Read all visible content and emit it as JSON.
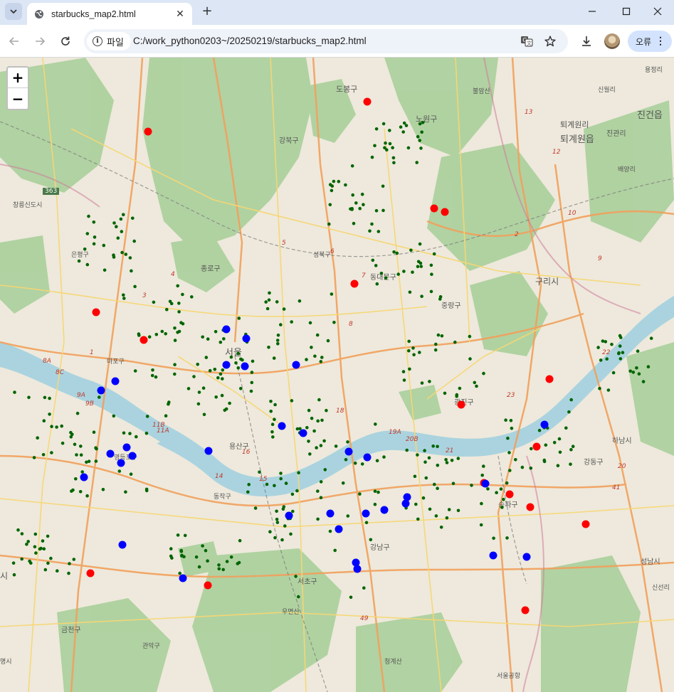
{
  "browser": {
    "tab_title": "starbucks_map2.html",
    "chip_label": "파일",
    "url": "C:/work_python0203~/20250219/starbucks_map2.html",
    "error_label": "오류",
    "new_tab_glyph": "+",
    "close_glyph": "✕",
    "menu_glyph": "⌄",
    "dots_glyph": "⋮",
    "colors": {
      "tabbar": "#dce6f5",
      "pill": "#d3e3fd"
    }
  },
  "map": {
    "zoom_in_label": "+",
    "zoom_out_label": "−",
    "colors": {
      "red_marker": "#ff0000",
      "blue_marker": "#0000ff",
      "green_marker": "#006400",
      "river": "#aad3df",
      "forest": "#add19e"
    },
    "place_labels": [
      "도봉구",
      "노원구",
      "불암산",
      "퇴계원리",
      "퇴계원읍",
      "진건읍",
      "신월리",
      "용정리",
      "진관리",
      "배양리",
      "강북구",
      "성북구",
      "종로구",
      "중랑구",
      "동대문구",
      "구리시",
      "서울",
      "용산구",
      "광진구",
      "마포구",
      "영등포구",
      "동작구",
      "서초구",
      "강남구",
      "송파구",
      "강동구",
      "우면산",
      "금천구",
      "관악구",
      "청계산",
      "서울공항",
      "성남시",
      "하남시",
      "신선리",
      "창릉신도시",
      "은평구",
      "명시",
      "시",
      "363"
    ],
    "route_labels": [
      "13",
      "12",
      "10",
      "9",
      "8",
      "7",
      "6",
      "5",
      "4",
      "3",
      "2",
      "1",
      "8A",
      "8C",
      "9A",
      "9B",
      "11A",
      "11B",
      "19A",
      "20B",
      "18",
      "14",
      "15",
      "16",
      "21",
      "22",
      "23",
      "20",
      "49",
      "41"
    ]
  }
}
